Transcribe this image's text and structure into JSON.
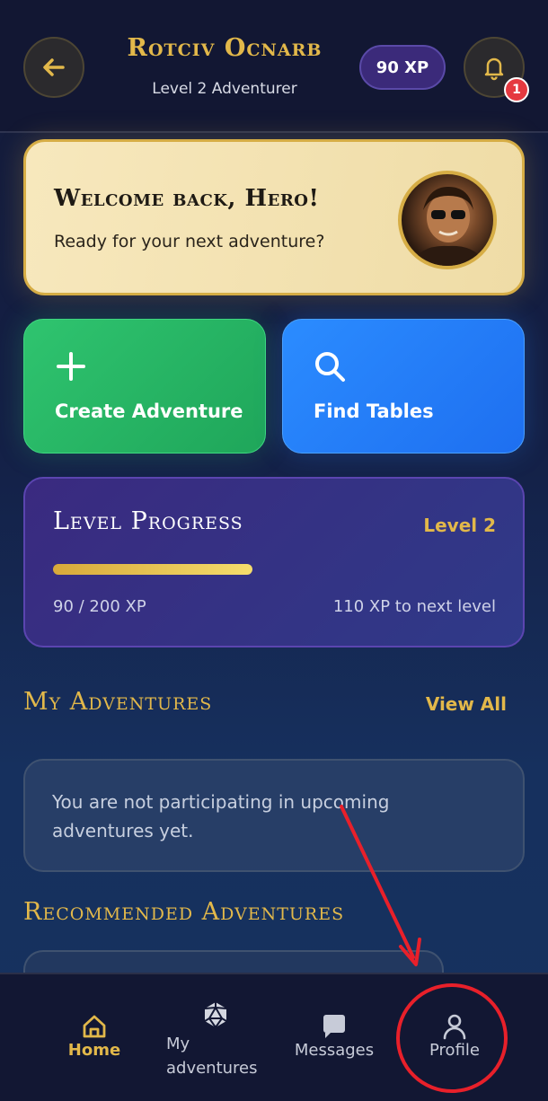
{
  "header": {
    "user_name": "Rotciv Ocnarb",
    "user_level": "Level 2 Adventurer",
    "xp_badge": "90 XP",
    "notification_count": "1",
    "back_icon": "arrow-left-icon",
    "bell_icon": "bell-icon"
  },
  "welcome": {
    "title": "Welcome back, Hero!",
    "subtitle": "Ready for your next adventure?"
  },
  "actions": [
    {
      "label": "Create Adventure",
      "icon": "plus-icon",
      "color": "#2fc46f"
    },
    {
      "label": "Find Tables",
      "icon": "search-icon",
      "color": "#2b8cff"
    }
  ],
  "progress": {
    "title": "Level Progress",
    "level": "Level 2",
    "fill_fraction": 0.45,
    "current": "90 / 200 XP",
    "next": "110 XP to next level"
  },
  "my_adventures": {
    "title": "My Adventures",
    "view_all": "View All",
    "empty_text": "You are not participating in upcoming adventures yet."
  },
  "recommended": {
    "title": "Recommended Adventures"
  },
  "nav": {
    "home": "Home",
    "my_adventures": "My adventures",
    "messages": "Messages",
    "profile": "Profile"
  },
  "colors": {
    "accent_gold": "#e2b84a",
    "annotation_red": "#e8202a"
  }
}
